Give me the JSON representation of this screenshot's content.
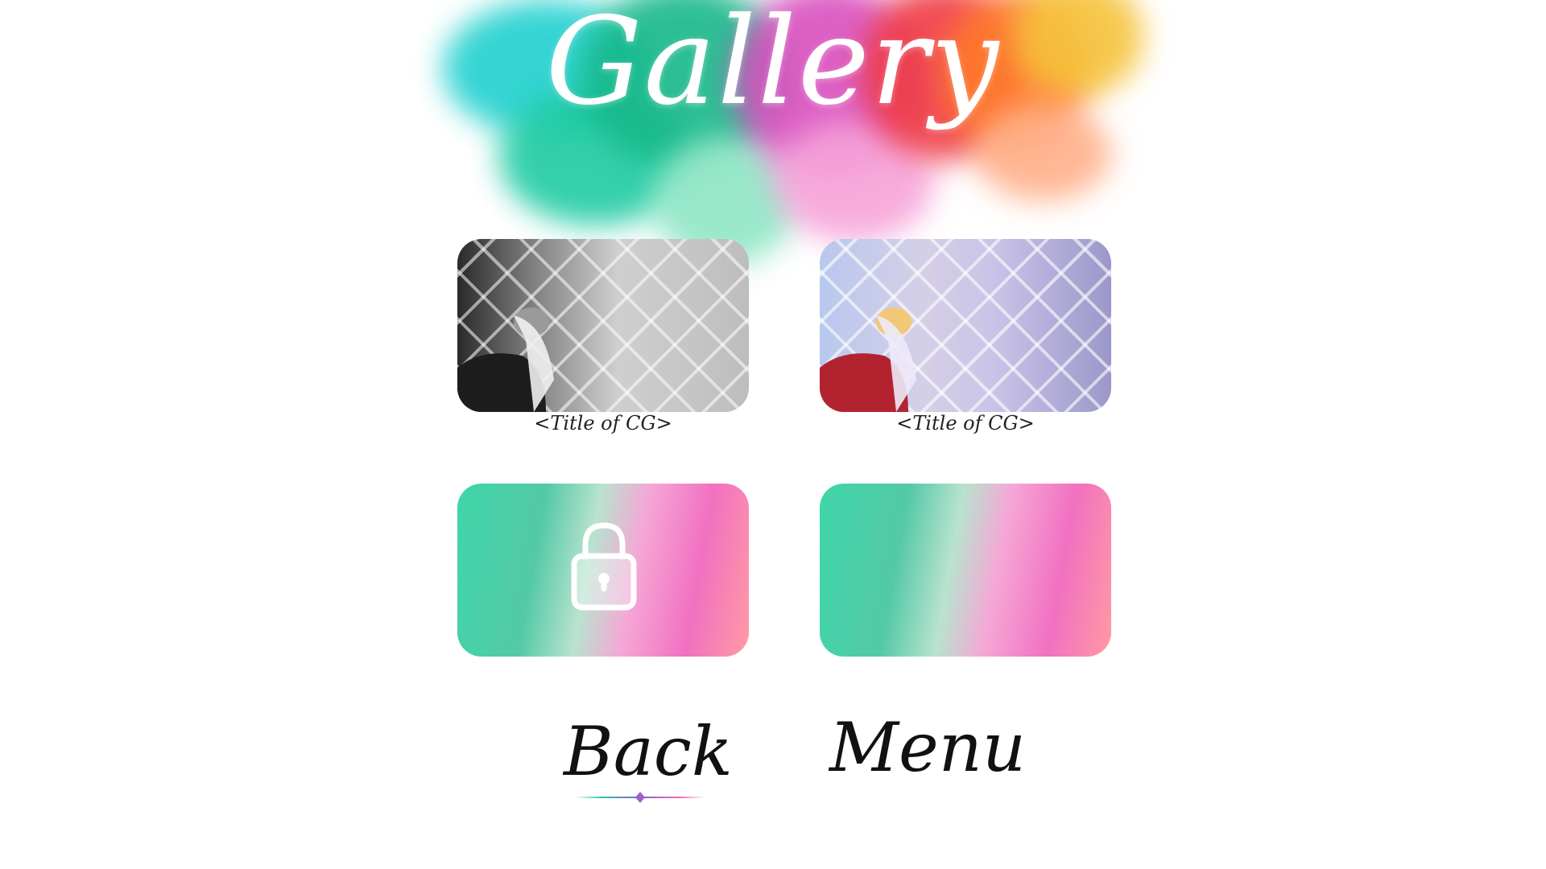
{
  "screen": {
    "title": "Gallery"
  },
  "gallery": {
    "items": [
      {
        "caption": "<Title of CG>",
        "state": "unlocked"
      },
      {
        "caption": "<Title of CG>",
        "state": "unlocked"
      },
      {
        "caption": "",
        "state": "locked"
      },
      {
        "caption": "",
        "state": "empty"
      }
    ]
  },
  "nav": {
    "back_label": "Back",
    "menu_label": "Menu",
    "selected": "Back"
  },
  "colors": {
    "splash_teal": "#1fc8b8",
    "splash_green": "#16b98a",
    "splash_pink": "#f06ac1",
    "splash_red": "#ef3b45",
    "splash_orange": "#ff8a2a",
    "splash_yellow": "#f5c23a",
    "text": "#111111"
  },
  "icons": {
    "lock": "lock-icon",
    "selection_marker": "diamond-underline-icon"
  }
}
